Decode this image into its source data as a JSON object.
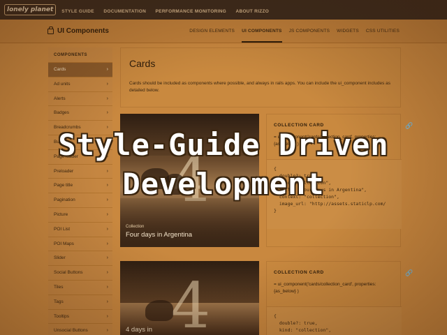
{
  "topbar": {
    "logo": "lonely planet",
    "links": [
      "STYLE GUIDE",
      "DOCUMENTATION",
      "PERFORMANCE MONITORING",
      "ABOUT RIZZO"
    ]
  },
  "header": {
    "title": "UI Components",
    "tabs": [
      "DESIGN ELEMENTS",
      "UI COMPONENTS",
      "JS COMPONENTS",
      "WIDGETS",
      "CSS UTILITIES"
    ],
    "active_tab": "UI COMPONENTS"
  },
  "sidebar": {
    "title": "COMPONENTS",
    "items": [
      "Cards",
      "Ad units",
      "Alerts",
      "Badges",
      "Breadcrumbs",
      "Buttons",
      "Page loader",
      "Preloader",
      "Page title",
      "Pagination",
      "Picture",
      "POI List",
      "POI Maps",
      "Slider",
      "Social Buttons",
      "Tiles",
      "Tags",
      "Tooltips",
      "Unsocial Buttons"
    ],
    "active": "Cards"
  },
  "main": {
    "title": "Cards",
    "description": "Cards should be included as components where possible, and always in rails apps. You can include the ui_component includes as detailed below.",
    "cards": [
      {
        "caption_small": "Collection",
        "caption_big": "Four days in Argentina",
        "panel_title": "COLLECTION CARD",
        "call": "= ui_component('cards/collection_card', properties: {as_below} )",
        "code": "{\n  double?: true,\n  kind: \"collection\",\n  title: \"Four days in Argentina\",\n  context: \"collection\",\n  image_url: \"http://assets.staticlp.com/\n}"
      },
      {
        "caption_small": "",
        "caption_big": "4 days in",
        "panel_title": "COLLECTION CARD",
        "call": "= ui_component('cards/collection_card', properties: {as_below} )",
        "code": "{\n  double?: true,\n  kind: \"collection\","
      }
    ]
  },
  "overlay": {
    "line1": "Style-Guide Driven",
    "line2": "Development"
  },
  "colors": {
    "tint": "#c9883f",
    "topbar": "#3b2a1c",
    "sidebar_active": "#8a5a2a"
  }
}
